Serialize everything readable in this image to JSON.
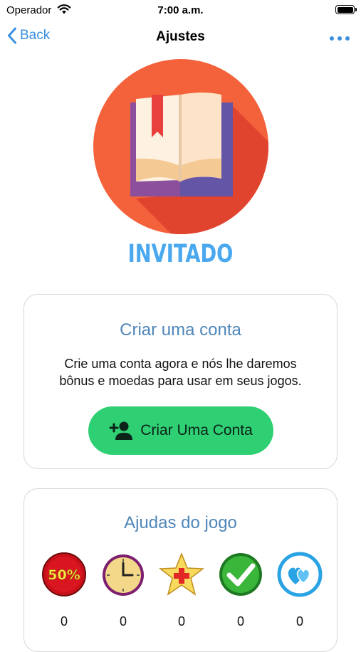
{
  "status_bar": {
    "carrier": "Operador",
    "time": "7:00 a.m."
  },
  "nav": {
    "back_label": "Back",
    "title": "Ajustes"
  },
  "profile": {
    "label": "INVITADO"
  },
  "create_account_card": {
    "title": "Criar uma conta",
    "description_line1": "Crie uma conta agora e nós lhe daremos",
    "description_line2": "bônus e moedas para usar em seus jogos.",
    "button_label": "Criar Uma Conta"
  },
  "game_aids_card": {
    "title": "Ajudas do jogo",
    "aids": [
      {
        "icon": "fifty-fifty-icon",
        "icon_text": "50%",
        "count": "0"
      },
      {
        "icon": "clock-icon",
        "count": "0"
      },
      {
        "icon": "star-medic-icon",
        "count": "0"
      },
      {
        "icon": "check-icon",
        "count": "0"
      },
      {
        "icon": "hearts-icon",
        "count": "0"
      }
    ]
  },
  "colors": {
    "accent": "#3b8fe0",
    "guest_label": "#4aa8ef",
    "card_title": "#4f86b9",
    "create_button": "#2fcf73",
    "logo_circle": "#f4623b"
  }
}
